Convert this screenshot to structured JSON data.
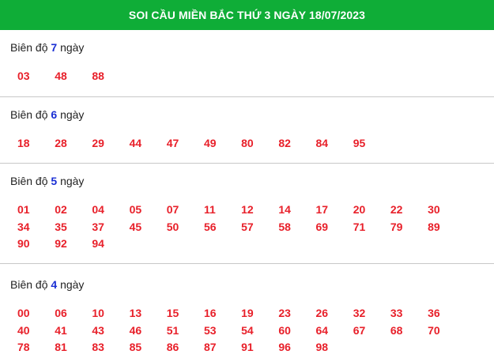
{
  "header": {
    "title": "SOI CẦU MIỀN BẮC THỨ 3 NGÀY 18/07/2023"
  },
  "label_prefix": "Biên độ",
  "label_suffix": "ngày",
  "sections": [
    {
      "days": "7",
      "numbers": [
        "03",
        "48",
        "88"
      ]
    },
    {
      "days": "6",
      "numbers": [
        "18",
        "28",
        "29",
        "44",
        "47",
        "49",
        "80",
        "82",
        "84",
        "95"
      ]
    },
    {
      "days": "5",
      "numbers": [
        "01",
        "02",
        "04",
        "05",
        "07",
        "11",
        "12",
        "14",
        "17",
        "20",
        "22",
        "30",
        "34",
        "35",
        "37",
        "45",
        "50",
        "56",
        "57",
        "58",
        "69",
        "71",
        "79",
        "89",
        "90",
        "92",
        "94"
      ]
    },
    {
      "days": "4",
      "numbers": [
        "00",
        "06",
        "10",
        "13",
        "15",
        "16",
        "19",
        "23",
        "26",
        "32",
        "33",
        "36",
        "40",
        "41",
        "43",
        "46",
        "51",
        "53",
        "54",
        "60",
        "64",
        "67",
        "68",
        "70",
        "78",
        "81",
        "83",
        "85",
        "86",
        "87",
        "91",
        "96",
        "98"
      ]
    }
  ]
}
